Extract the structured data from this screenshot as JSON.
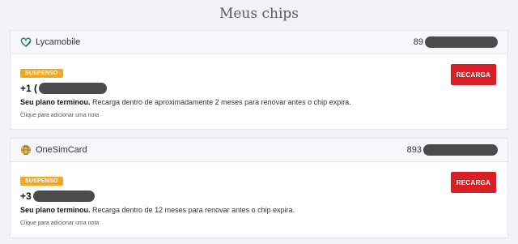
{
  "page": {
    "title": "Meus chips"
  },
  "colors": {
    "badge": "#f5a623",
    "button": "#d81f26",
    "mask": "#4b4b4b"
  },
  "chips": [
    {
      "provider": "Lycamobile",
      "provider_icon": "lycamobile-heart-logo",
      "sim_prefix": "89",
      "status": "SUSPENSO",
      "phone_prefix": "+1 (",
      "message_bold": "Seu plano terminou.",
      "message_text": " Recarga dentro de aproximadamente 2 meses para renovar antes o chip expira.",
      "note": "Clique para adicionar uma nota",
      "button": "RECARGA"
    },
    {
      "provider": "OneSimCard",
      "provider_icon": "onesimcard-globe-logo",
      "sim_prefix": "893",
      "status": "SUSPENSO",
      "phone_prefix": "+3",
      "message_bold": "Seu plano terminou.",
      "message_text": " Recarga dentro de 12 meses para renovar antes o chip expira.",
      "note": "Clique para adicionar uma nota",
      "button": "RECARGA"
    }
  ]
}
